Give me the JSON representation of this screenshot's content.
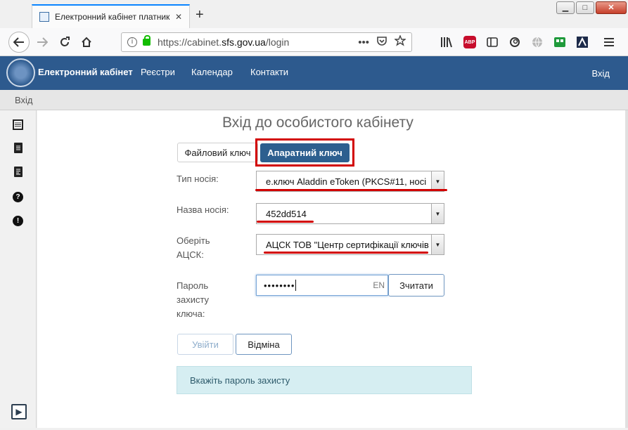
{
  "browser": {
    "tab_title": "Електронний кабінет платник",
    "tab_close": "✕",
    "new_tab": "+",
    "window_buttons": {
      "minimize": "▁",
      "maximize": "□",
      "close": "✕"
    },
    "url_prefix": "https://cabinet.",
    "url_domain": "sfs.gov.ua",
    "url_path": "/login",
    "url_more": "•••",
    "abp_label": "ABP"
  },
  "site": {
    "brand": "Електронний кабінет",
    "menu": [
      "Реєстри",
      "Календар",
      "Контакти"
    ],
    "login_link": "Вхід"
  },
  "breadcrumb": "Вхід",
  "sidebar_icons": [
    "registry-icon",
    "document-icon",
    "document-list-icon",
    "help-icon",
    "warning-icon",
    "play-icon"
  ],
  "form": {
    "title": "Вхід до особистого кабінету",
    "tab_file_key": "Файловий ключ",
    "tab_hardware_key": "Апаратний ключ",
    "media_type_label": "Тип носія:",
    "media_type_value": "е.ключ Aladdin eToken (PKCS#11, носі",
    "media_name_label": "Назва носія:",
    "media_name_value": "452dd514",
    "acsk_label": "Оберіть АЦСК:",
    "acsk_value": "АЦСК ТОВ \"Центр сертифікації ключів",
    "password_label": "Пароль захисту ключа:",
    "password_mask": "••••••••",
    "input_lang": "EN",
    "read_button": "Зчитати",
    "login_button": "Увійти",
    "cancel_button": "Відміна",
    "hint": "Вкажіть пароль захисту"
  },
  "colors": {
    "header_blue": "#2d5a8e",
    "active_tab": "#2d5f8f",
    "highlight_red": "#d20000",
    "alert_bg": "#d6eef2"
  }
}
